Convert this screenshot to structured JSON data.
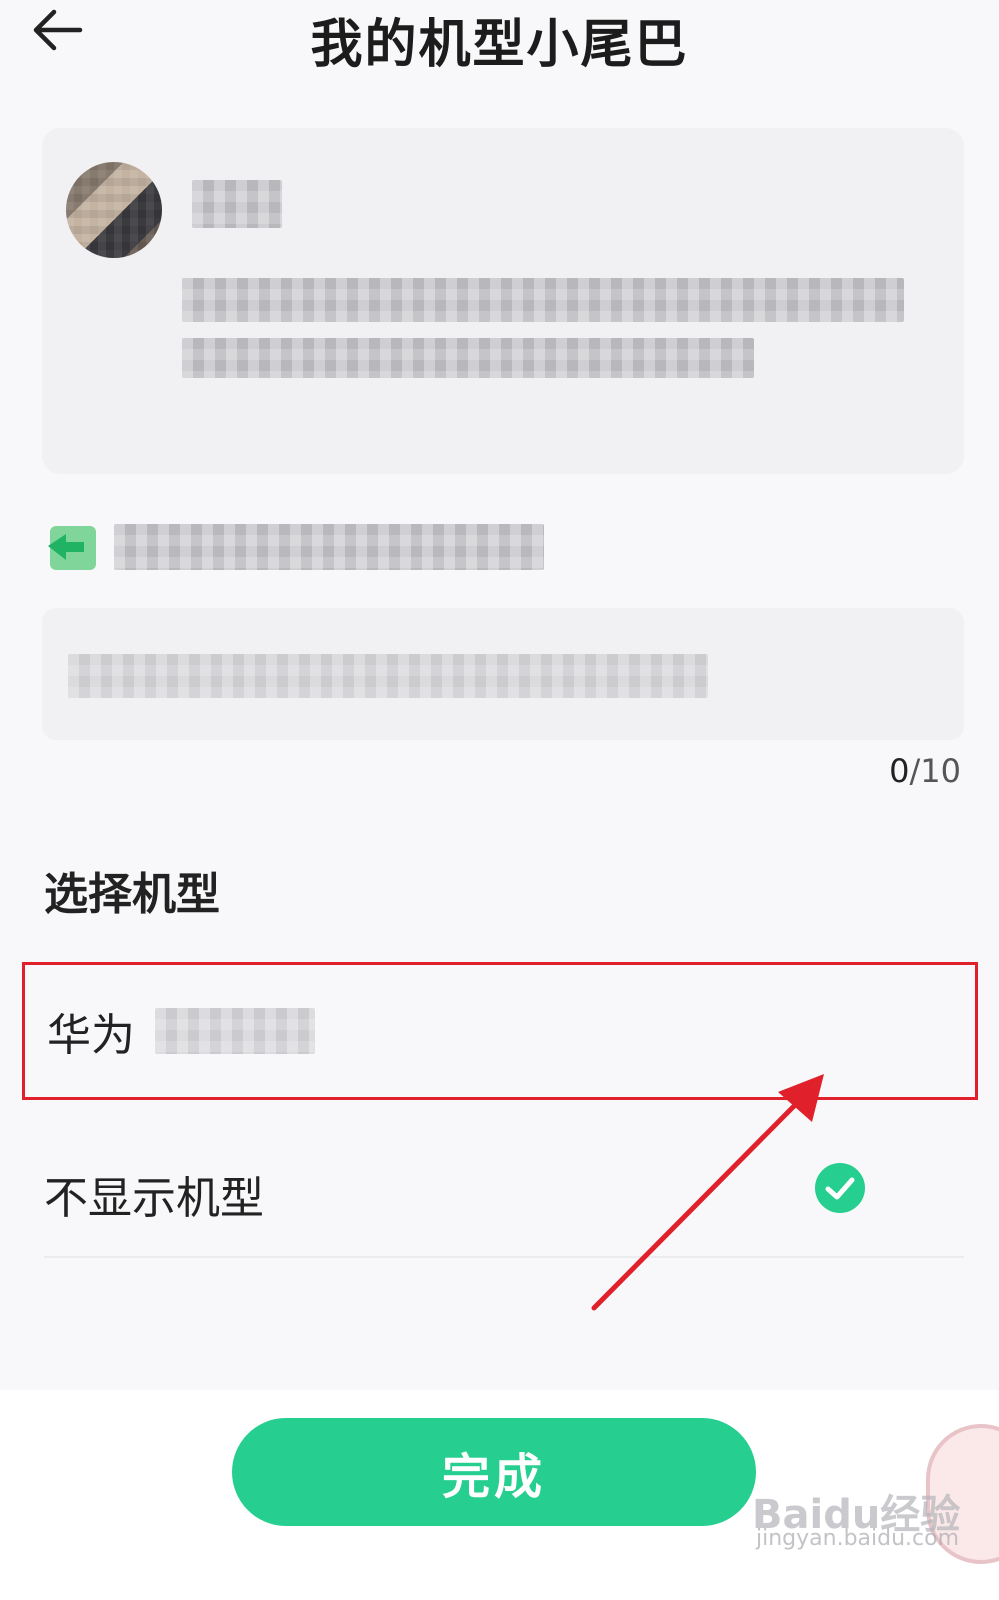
{
  "header": {
    "title": "我的机型小尾巴",
    "back_icon": "arrow-left-icon"
  },
  "custom_tail": {
    "counter_current": "0",
    "counter_max": "/10"
  },
  "model_section": {
    "title": "选择机型",
    "options": [
      {
        "label": "华为",
        "selected": false
      },
      {
        "label": "不显示机型",
        "selected": true
      }
    ]
  },
  "footer": {
    "done_label": "完成"
  },
  "colors": {
    "accent": "#26cf8f",
    "highlight_box": "#e0202a",
    "arrow": "#e0202a"
  },
  "watermark": {
    "brand": "Baidu经验",
    "url": "jingyan.baidu.com"
  }
}
